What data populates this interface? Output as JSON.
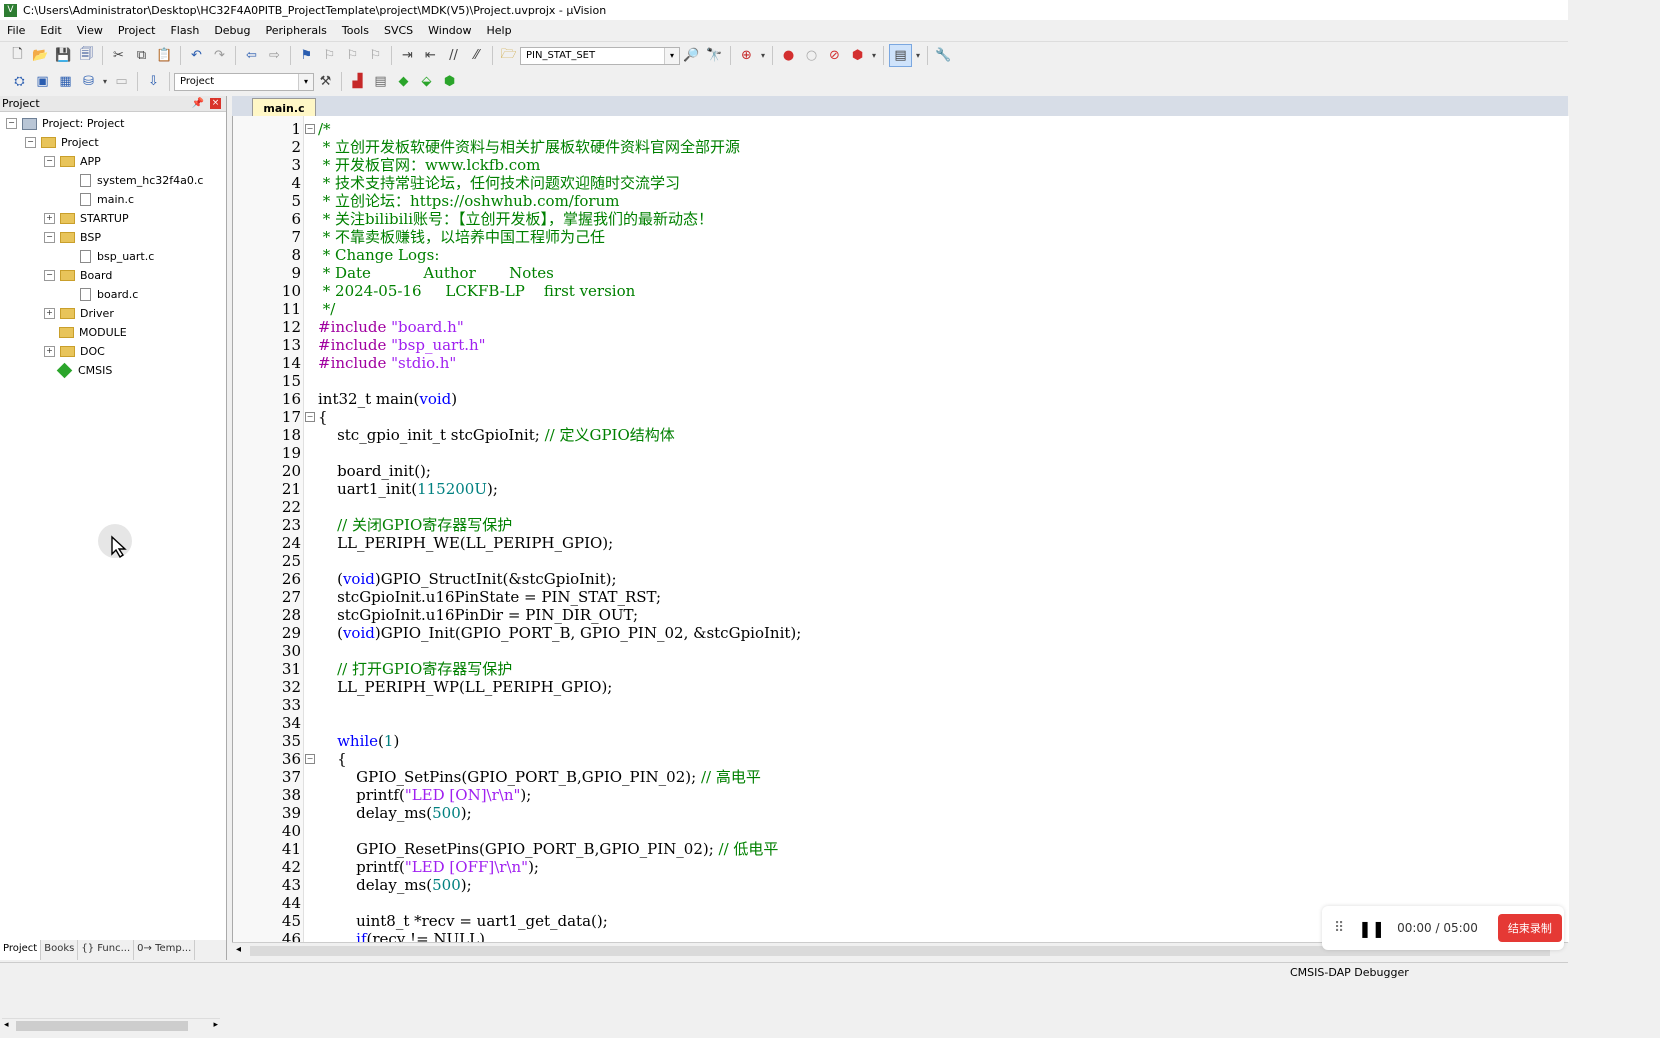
{
  "window": {
    "title": "C:\\Users\\Administrator\\Desktop\\HC32F4A0PITB_ProjectTemplate\\project\\MDK(V5)\\Project.uvprojx - µVision"
  },
  "menu": [
    "File",
    "Edit",
    "View",
    "Project",
    "Flash",
    "Debug",
    "Peripherals",
    "Tools",
    "SVCS",
    "Window",
    "Help"
  ],
  "toolbar": {
    "find_combo": "PIN_STAT_SET",
    "target_combo": "Project"
  },
  "project_panel": {
    "title": "Project",
    "tree": [
      {
        "label": "Project: Project"
      },
      {
        "label": "Project"
      },
      {
        "label": "APP"
      },
      {
        "label": "system_hc32f4a0.c"
      },
      {
        "label": "main.c"
      },
      {
        "label": "STARTUP"
      },
      {
        "label": "BSP"
      },
      {
        "label": "bsp_uart.c"
      },
      {
        "label": "Board"
      },
      {
        "label": "board.c"
      },
      {
        "label": "Driver"
      },
      {
        "label": "MODULE"
      },
      {
        "label": "DOC"
      },
      {
        "label": "CMSIS"
      }
    ],
    "bottom_tabs": [
      "Project",
      "Books",
      "{} Func...",
      "0→ Temp..."
    ]
  },
  "editor": {
    "tab": "main.c",
    "line_numbers": [
      "1",
      "2",
      "3",
      "4",
      "5",
      "6",
      "7",
      "8",
      "9",
      "10",
      "11",
      "12",
      "13",
      "14",
      "15",
      "16",
      "17",
      "18",
      "19",
      "20",
      "21",
      "22",
      "23",
      "24",
      "25",
      "26",
      "27",
      "28",
      "29",
      "30",
      "31",
      "32",
      "33",
      "34",
      "35",
      "36",
      "37",
      "38",
      "39",
      "40",
      "41",
      "42",
      "43",
      "44",
      "45",
      "46"
    ]
  },
  "status": {
    "debugger": "CMSIS-DAP Debugger"
  },
  "recorder": {
    "time": "00:00 / 05:00",
    "stop_label": "结束录制"
  },
  "colors": {
    "comment": "#008000",
    "keyword": "#0000ff",
    "string": "#a020f0",
    "number": "#008080",
    "tab_active": "#fff7c6"
  }
}
